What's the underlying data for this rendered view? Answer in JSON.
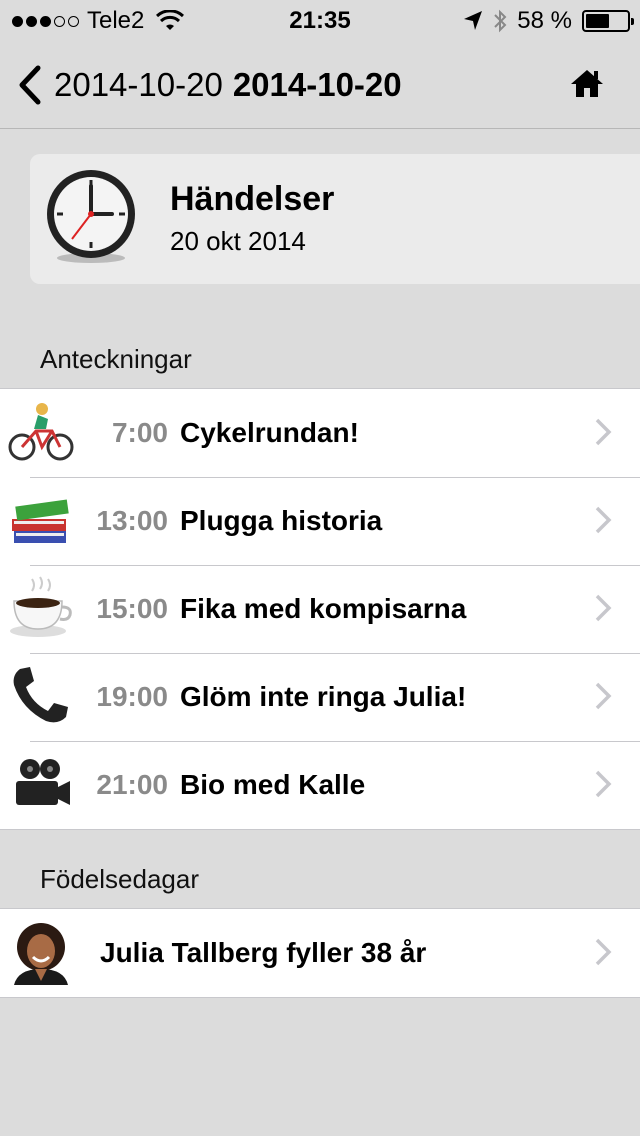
{
  "status_bar": {
    "carrier": "Tele2",
    "time": "21:35",
    "battery_text": "58 %",
    "battery_level": 0.58,
    "signal_strength": 3,
    "signal_max": 5
  },
  "nav": {
    "back_title": "2014-10-20",
    "title": "2014-10-20"
  },
  "header_card": {
    "title": "Händelser",
    "date": "20 okt 2014",
    "icon": "clock-icon"
  },
  "sections": {
    "notes": {
      "title": "Anteckningar",
      "items": [
        {
          "time": "7:00",
          "text": "Cykelrundan!",
          "icon": "cyclist-icon"
        },
        {
          "time": "13:00",
          "text": "Plugga historia",
          "icon": "books-icon"
        },
        {
          "time": "15:00",
          "text": "Fika med kompisarna",
          "icon": "coffee-cup-icon"
        },
        {
          "time": "19:00",
          "text": "Glöm inte ringa Julia!",
          "icon": "phone-icon"
        },
        {
          "time": "21:00",
          "text": "Bio med Kalle",
          "icon": "movie-camera-icon"
        }
      ]
    },
    "birthdays": {
      "title": "Födelsedagar",
      "items": [
        {
          "text": "Julia Tallberg fyller 38 år",
          "icon": "avatar"
        }
      ]
    }
  },
  "colors": {
    "background": "#dcdcdc",
    "card": "#ebebeb",
    "time_text": "#8a8a8a",
    "chevron": "#c7c7cc"
  }
}
